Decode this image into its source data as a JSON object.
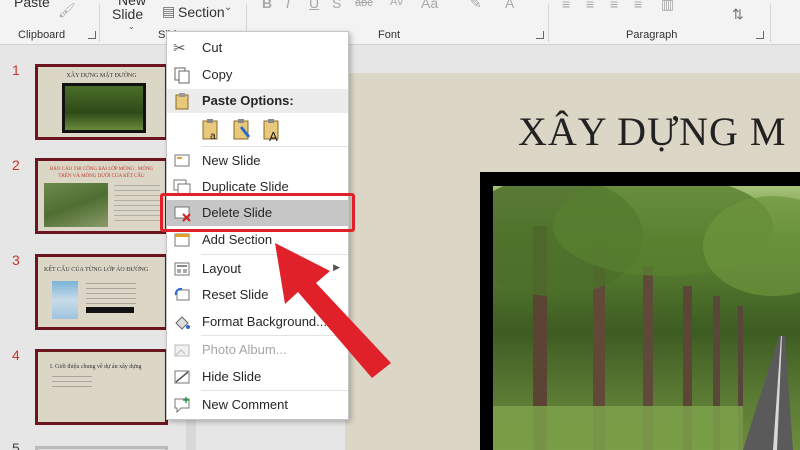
{
  "ribbon": {
    "paste_label": "Paste",
    "new_slide_top": "New",
    "new_slide_label": "Slide",
    "section_label": "Section",
    "groups": {
      "clipboard": "Clipboard",
      "slides": "Slides",
      "font": "Font",
      "paragraph": "Paragraph"
    }
  },
  "thumbnails": [
    {
      "number": "1",
      "title": "XÂY DỰNG MẶT ĐƯỜNG"
    },
    {
      "number": "2",
      "title": "BÁO CÁO THI CÔNG BẢI LỚP MÓNG : MÓNG TRÊN VÀ MÓNG DƯỚI CỦA KẾT CẤU"
    },
    {
      "number": "3",
      "title": "KẾT CẤU CỦA TỪNG LỚP ÁO ĐƯỜNG"
    },
    {
      "number": "4",
      "title": "I. Giới thiệu chung về dự án xây dựng"
    },
    {
      "number": "5",
      "title": ""
    }
  ],
  "slide": {
    "title": "XÂY DỰNG M"
  },
  "context_menu": {
    "cut": "Cut",
    "copy": "Copy",
    "paste_options": "Paste Options:",
    "new_slide": "New Slide",
    "duplicate_slide": "Duplicate Slide",
    "delete_slide": "Delete Slide",
    "add_section": "Add Section",
    "layout": "Layout",
    "reset_slide": "Reset Slide",
    "format_background": "Format Background...",
    "photo_album": "Photo Album...",
    "hide_slide": "Hide Slide",
    "new_comment": "New Comment"
  },
  "colors": {
    "highlight_box": "#e0212a",
    "thumb_border": "#6b1520",
    "slide_bg": "#dcd6c7"
  }
}
